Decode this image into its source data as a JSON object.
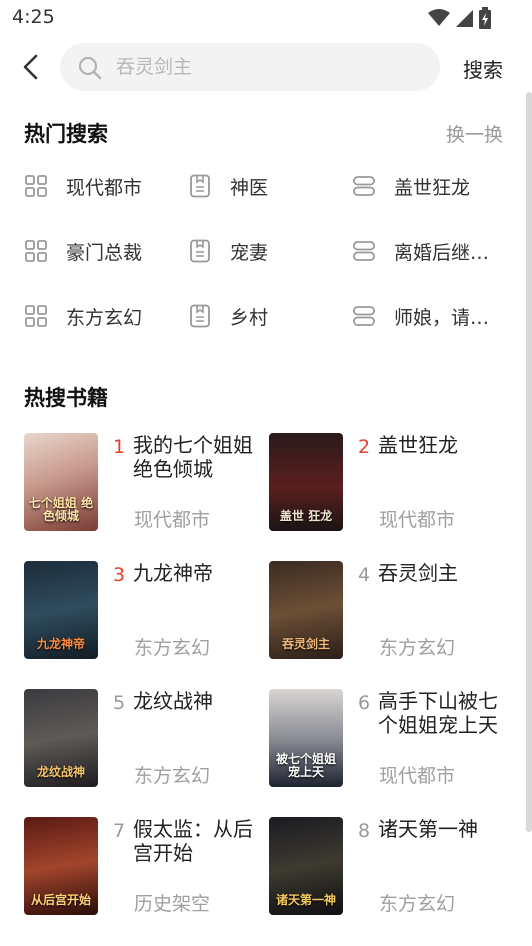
{
  "status": {
    "time": "4:25"
  },
  "search": {
    "placeholder": "吞灵剑主",
    "button_label": "搜索"
  },
  "hot_search": {
    "title": "热门搜索",
    "refresh_label": "换一换",
    "tags": [
      {
        "label": "现代都市",
        "icon": "grid-icon"
      },
      {
        "label": "神医",
        "icon": "book-icon"
      },
      {
        "label": "盖世狂龙",
        "icon": "stack-icon"
      },
      {
        "label": "豪门总裁",
        "icon": "grid-icon"
      },
      {
        "label": "宠妻",
        "icon": "book-icon"
      },
      {
        "label": "离婚后继…",
        "icon": "stack-icon"
      },
      {
        "label": "东方玄幻",
        "icon": "grid-icon"
      },
      {
        "label": "乡村",
        "icon": "book-icon"
      },
      {
        "label": "师娘，请…",
        "icon": "stack-icon"
      }
    ]
  },
  "hot_books": {
    "title": "热搜书籍",
    "books": [
      {
        "rank": "1",
        "title": "我的七个姐姐绝色倾城",
        "genre": "现代都市",
        "cover_text": "七个姐姐 绝色倾城",
        "accent": "#e2432a"
      },
      {
        "rank": "2",
        "title": "盖世狂龙",
        "genre": "现代都市",
        "cover_text": "盖世 狂龙",
        "accent": "#e2432a"
      },
      {
        "rank": "3",
        "title": "九龙神帝",
        "genre": "东方玄幻",
        "cover_text": "九龙神帝",
        "accent": "#e2432a"
      },
      {
        "rank": "4",
        "title": "吞灵剑主",
        "genre": "东方玄幻",
        "cover_text": "吞灵剑主",
        "accent": "#999999"
      },
      {
        "rank": "5",
        "title": "龙纹战神",
        "genre": "东方玄幻",
        "cover_text": "龙纹战神",
        "accent": "#999999"
      },
      {
        "rank": "6",
        "title": "高手下山被七个姐姐宠上天",
        "genre": "现代都市",
        "cover_text": "被七个姐姐 宠上天",
        "accent": "#999999"
      },
      {
        "rank": "7",
        "title": "假太监：从后宫开始",
        "genre": "历史架空",
        "cover_text": "从后宫开始",
        "accent": "#999999"
      },
      {
        "rank": "8",
        "title": "诸天第一神",
        "genre": "东方玄幻",
        "cover_text": "诸天第一神",
        "accent": "#999999"
      }
    ]
  }
}
